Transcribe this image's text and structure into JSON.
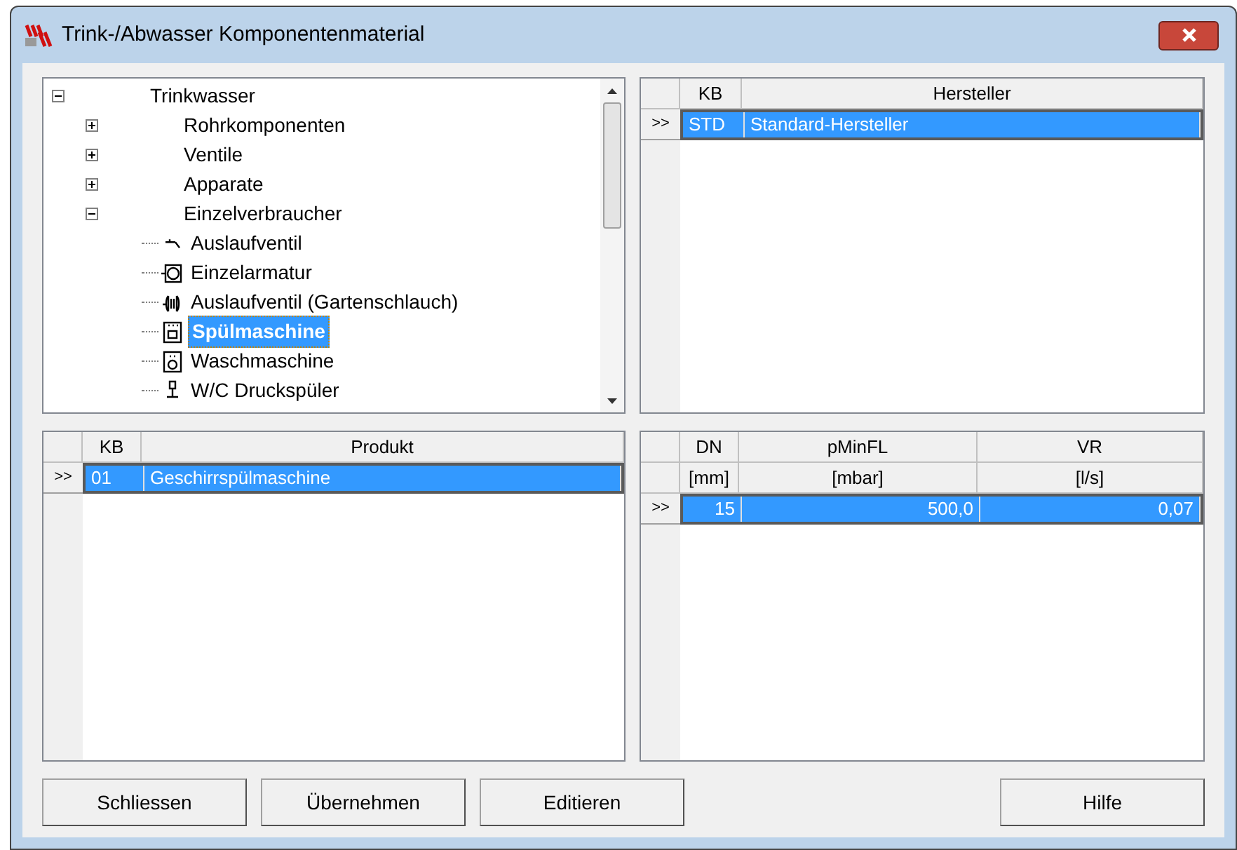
{
  "window": {
    "title": "Trink-/Abwasser Komponentenmaterial"
  },
  "tree": [
    {
      "label": "Trinkwasser",
      "expanded": true,
      "selected": false,
      "children": [
        {
          "label": "Rohrkomponenten",
          "expanded": false,
          "selected": false
        },
        {
          "label": "Ventile",
          "expanded": false,
          "selected": false
        },
        {
          "label": "Apparate",
          "expanded": false,
          "selected": false
        },
        {
          "label": "Einzelverbraucher",
          "expanded": true,
          "selected": false,
          "children": [
            {
              "label": "Auslaufventil",
              "kind": "tap",
              "selected": false
            },
            {
              "label": "Einzelarmatur",
              "kind": "fitting",
              "selected": false
            },
            {
              "label": "Auslaufventil (Gartenschlauch)",
              "kind": "hose",
              "selected": false
            },
            {
              "label": "Spülmaschine",
              "kind": "dishwasher",
              "selected": true
            },
            {
              "label": "Waschmaschine",
              "kind": "washer",
              "selected": false
            },
            {
              "label": "W/C Druckspüler",
              "kind": "flush",
              "selected": false
            }
          ]
        }
      ]
    }
  ],
  "hersteller_table": {
    "header_rows": [
      [
        "KB",
        "Hersteller"
      ]
    ],
    "rows": [
      {
        "cells": [
          "STD",
          "Standard-Hersteller"
        ],
        "selected": true,
        "marker": ">>"
      }
    ]
  },
  "produkt_table": {
    "header_rows": [
      [
        "KB",
        "Produkt"
      ]
    ],
    "rows": [
      {
        "cells": [
          "01",
          "Geschirrspülmaschine"
        ],
        "selected": true,
        "marker": ">>"
      }
    ]
  },
  "werte_table": {
    "header_rows": [
      [
        "DN",
        "pMinFL",
        "VR"
      ],
      [
        "[mm]",
        "[mbar]",
        "[l/s]"
      ]
    ],
    "rows": [
      {
        "cells": [
          "15",
          "500,0",
          "0,07"
        ],
        "selected": true,
        "marker": ">>"
      }
    ]
  },
  "buttons_left": [
    "Schliessen",
    "Übernehmen",
    "Editieren"
  ],
  "buttons_right": [
    "Hilfe"
  ]
}
